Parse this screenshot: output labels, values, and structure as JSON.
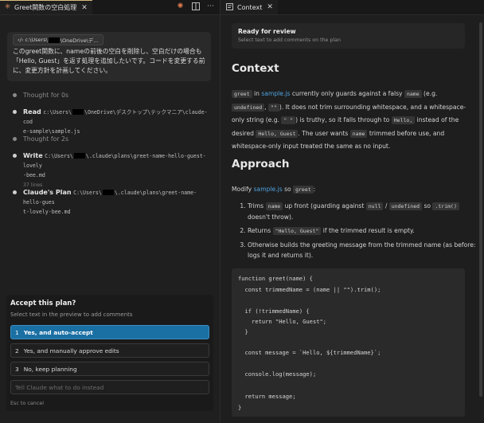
{
  "left_tab": {
    "title": "Greet関数の空白処理",
    "close": "✕"
  },
  "user_message": {
    "file_chip_prefix": "‹/› c:\\Users\\",
    "file_chip_suffix": "\\OneDrive\\デ…",
    "text_line1": "このgreet関数に、nameの前後の空白を削除し、空白だけの場合も",
    "text_line2": "「Hello, Guest」を返す処理を追加したいです。コードを変更する前",
    "text_line3": "に、変更方針を計画してください。"
  },
  "steps": [
    {
      "label": "Thought for 0s"
    },
    {
      "label": "Read",
      "path1a": "c:\\Users\\",
      "path1b": "\\OneDrive\\デスクトップ\\テックマニア\\claude-cod",
      "path2": "e-sample\\sample.js"
    },
    {
      "label": "Thought for 2s"
    },
    {
      "label": "Write",
      "path1a": "C:\\Users\\",
      "path1b": "\\.claude\\plans\\greet-name-hello-guest-lovely",
      "path2": "-bee.md",
      "sub": "37 lines"
    },
    {
      "label": "Claude's Plan",
      "path1a": "C:\\Users\\",
      "path1b": "\\.claude\\plans\\greet-name-hello-gues",
      "path2": "t-lovely-bee.md"
    }
  ],
  "accept": {
    "title": "Accept this plan?",
    "subtitle": "Select text in the preview to add comments",
    "options": [
      {
        "num": "1",
        "label": "Yes, and auto-accept"
      },
      {
        "num": "2",
        "label": "Yes, and manually approve edits"
      },
      {
        "num": "3",
        "label": "No, keep planning"
      }
    ],
    "input_placeholder": "Tell Claude what to do instead",
    "esc_hint": "Esc to cancel"
  },
  "right_tab": {
    "title": "Context",
    "close": "✕"
  },
  "review": {
    "title": "Ready for review",
    "subtitle": "Select text to add comments on the plan"
  },
  "context": {
    "heading": "Context",
    "c_greet": "greet",
    "c_in": " in ",
    "c_samplejs": "sample.js",
    "c_t1": " currently only guards against a falsy ",
    "c_name": "name",
    "c_eg": " (e.g.",
    "c_undefined": "undefined",
    "c_comma": ", ",
    "c_empty": "\"\"",
    "c_t2": "). It does not trim surrounding whitespace, and a whitespace-",
    "c_t3": "only string (e.g. ",
    "c_space": "\" \"",
    "c_t4": ") is truthy, so it falls through to ",
    "c_hello": "Hello,",
    "c_t5": "  instead of the",
    "c_t6": "desired ",
    "c_helloguest": "Hello, Guest",
    "c_t7": ". The user wants ",
    "c_name2": "name",
    "c_t8": " trimmed before use, and",
    "c_t9": "whitespace-only input treated the same as no input."
  },
  "approach": {
    "heading": "Approach",
    "a_modify": "Modify ",
    "a_samplejs": "sample.js",
    "a_so": " so ",
    "a_greet": "greet",
    "a_colon": ":",
    "li1_a": "Trims ",
    "li1_name": "name",
    "li1_b": " up front (guarding against ",
    "li1_null": "null",
    "li1_slash": " / ",
    "li1_undef": "undefined",
    "li1_c": " so ",
    "li1_trim": ".trim()",
    "li1_d": " doesn't throw).",
    "li2_a": "Returns ",
    "li2_code": "\"Hello, Guest\"",
    "li2_b": " if the trimmed result is empty.",
    "li3": "Otherwise builds the greeting message from the trimmed name (as before: logs it and returns it)."
  },
  "code": {
    "l1": "function greet(name) {",
    "l2": "  const trimmedName = (name || \"\").trim();",
    "l3": "  if (!trimmedName) {",
    "l4": "    return \"Hello, Guest\";",
    "l5": "  }",
    "l6": "  const message = `Hello, ${trimmedName}`;",
    "l7": "  console.log(message);",
    "l8": "  return message;",
    "l9": "}"
  }
}
